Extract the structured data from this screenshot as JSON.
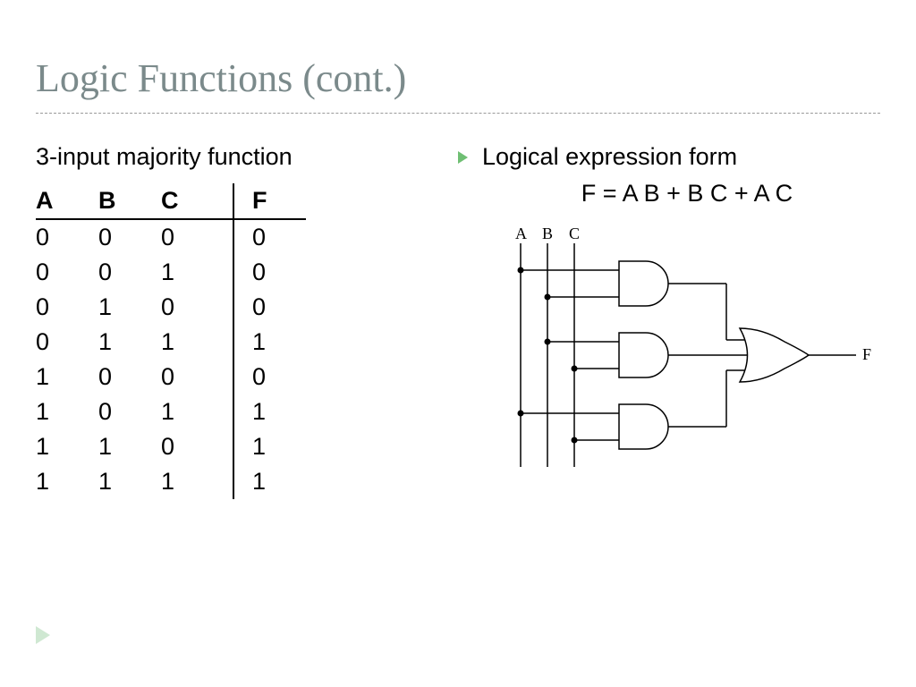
{
  "title": "Logic Functions (cont.)",
  "left": {
    "heading": "3-input majority function",
    "columns": [
      "A",
      "B",
      "C",
      "F"
    ],
    "rows": [
      [
        "0",
        "0",
        "0",
        "0"
      ],
      [
        "0",
        "0",
        "1",
        "0"
      ],
      [
        "0",
        "1",
        "0",
        "0"
      ],
      [
        "0",
        "1",
        "1",
        "1"
      ],
      [
        "1",
        "0",
        "0",
        "0"
      ],
      [
        "1",
        "0",
        "1",
        "1"
      ],
      [
        "1",
        "1",
        "0",
        "1"
      ],
      [
        "1",
        "1",
        "1",
        "1"
      ]
    ]
  },
  "right": {
    "bullet": "Logical expression form",
    "expression": "F = A B + B C + A C",
    "circuit": {
      "inputs": [
        "A",
        "B",
        "C"
      ],
      "output": "F",
      "gates": [
        {
          "type": "AND",
          "inputs": [
            "A",
            "B"
          ]
        },
        {
          "type": "AND",
          "inputs": [
            "B",
            "C"
          ]
        },
        {
          "type": "AND",
          "inputs": [
            "A",
            "C"
          ]
        }
      ],
      "combine": "OR"
    }
  }
}
